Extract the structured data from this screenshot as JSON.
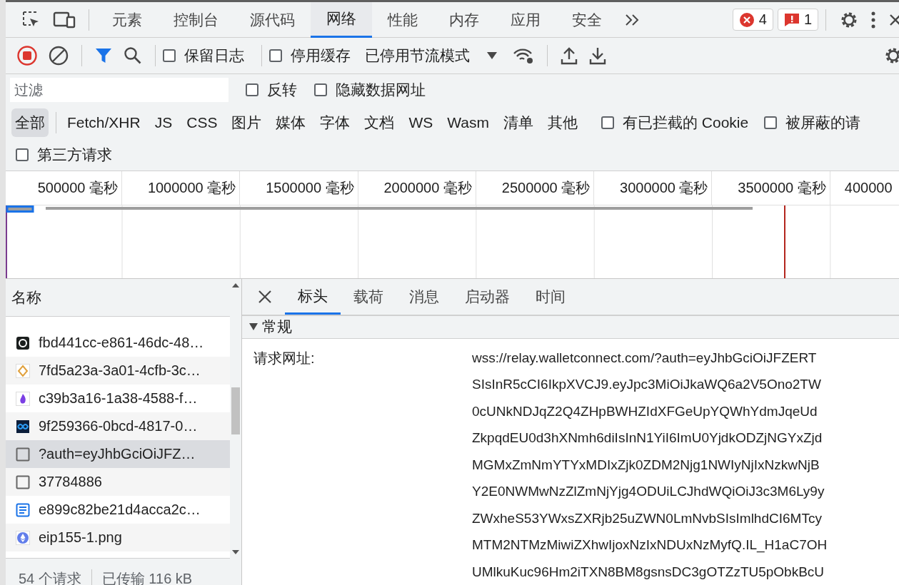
{
  "tabs": [
    {
      "label": "元素",
      "selected": false
    },
    {
      "label": "控制台",
      "selected": false
    },
    {
      "label": "源代码",
      "selected": false
    },
    {
      "label": "网络",
      "selected": true
    },
    {
      "label": "性能",
      "selected": false
    },
    {
      "label": "内存",
      "selected": false
    },
    {
      "label": "应用",
      "selected": false
    },
    {
      "label": "安全",
      "selected": false
    }
  ],
  "error_count": "4",
  "issue_count": "1",
  "toolbar": {
    "recording": true,
    "filter_active": true,
    "options": [
      {
        "label": "保留日志",
        "checked": false
      },
      {
        "label": "停用缓存",
        "checked": false
      }
    ],
    "throttling": "已停用节流模式"
  },
  "filter": {
    "placeholder": "过滤",
    "options": [
      {
        "label": "反转",
        "checked": false
      },
      {
        "label": "隐藏数据网址",
        "checked": false
      }
    ]
  },
  "types": [
    {
      "label": "全部",
      "selected": true
    },
    {
      "label": "Fetch/XHR",
      "selected": false
    },
    {
      "label": "JS",
      "selected": false
    },
    {
      "label": "CSS",
      "selected": false
    },
    {
      "label": "图片",
      "selected": false
    },
    {
      "label": "媒体",
      "selected": false
    },
    {
      "label": "字体",
      "selected": false
    },
    {
      "label": "文档",
      "selected": false
    },
    {
      "label": "WS",
      "selected": false
    },
    {
      "label": "Wasm",
      "selected": false
    },
    {
      "label": "清单",
      "selected": false
    },
    {
      "label": "其他",
      "selected": false
    }
  ],
  "type_options": [
    {
      "label": "有已拦截的 Cookie",
      "checked": false
    },
    {
      "label": "被屏蔽的请",
      "checked": false
    }
  ],
  "third_party": {
    "label": "第三方请求",
    "checked": false
  },
  "timeline": {
    "ticks": [
      "500000 毫秒",
      "1000000 毫秒",
      "1500000 毫秒",
      "2000000 毫秒",
      "2500000 毫秒",
      "3000000 毫秒",
      "3500000 毫秒",
      "400000"
    ]
  },
  "requests": {
    "header": "名称",
    "rows": [
      {
        "name": "fbd441cc-e861-46dc-48…",
        "kind": "dark",
        "selected": false
      },
      {
        "name": "7fd5a23a-3a01-4cfb-3c…",
        "kind": "gold",
        "selected": false
      },
      {
        "name": "c39b3a16-1a38-4588-f…",
        "kind": "flame",
        "selected": false
      },
      {
        "name": "9f259366-0bcd-4817-0…",
        "kind": "loop",
        "selected": false
      },
      {
        "name": "?auth=eyJhbGciOiJFZ…",
        "kind": "blank",
        "selected": true
      },
      {
        "name": "37784886",
        "kind": "blank",
        "selected": false
      },
      {
        "name": "e899c82be21d4acca2c…",
        "kind": "doc",
        "selected": false
      },
      {
        "name": "eip155-1.png",
        "kind": "eth",
        "selected": false
      }
    ],
    "summary": [
      "54 个请求",
      "已传输 116 kB"
    ]
  },
  "details": {
    "tabs": [
      {
        "label": "标头",
        "selected": true
      },
      {
        "label": "载荷",
        "selected": false
      },
      {
        "label": "消息",
        "selected": false
      },
      {
        "label": "启动器",
        "selected": false
      },
      {
        "label": "时间",
        "selected": false
      }
    ],
    "section": {
      "title": "常规",
      "expanded": true,
      "label": "请求网址:",
      "value_lines": [
        "wss://relay.walletconnect.com/?auth=eyJhbGciOiJFZERT",
        "SIsInR5cCI6IkpXVCJ9.eyJpc3MiOiJkaWQ6a2V5Ono2TW",
        "0cUNkNDJqZ2Q4ZHpBWHZIdXFGeUpYQWhYdmJqeUd",
        "ZkpqdEU0d3hXNmh6diIsInN1YiI6ImU0YjdkODZjNGYxZjd",
        "MGMxZmNmYTYxMDIxZjk0ZDM2Njg1NWIyNjIxNzkwNjB",
        "Y2E0NWMwNzZlZmNjYjg4ODUiLCJhdWQiOiJ3c3M6Ly9y",
        "ZWxheS53YWxsZXRjb25uZWN0LmNvbSIsImlhdCI6MTcy",
        "MTM2NTMzMiwiZXhwIjoxNzIxNDUxNzMyfQ.IL_H1aC7OH",
        "UMlkuKuc96Hm2iTXN8BM8gsnsDC3gOTZzTU5pObkBcU"
      ]
    }
  }
}
